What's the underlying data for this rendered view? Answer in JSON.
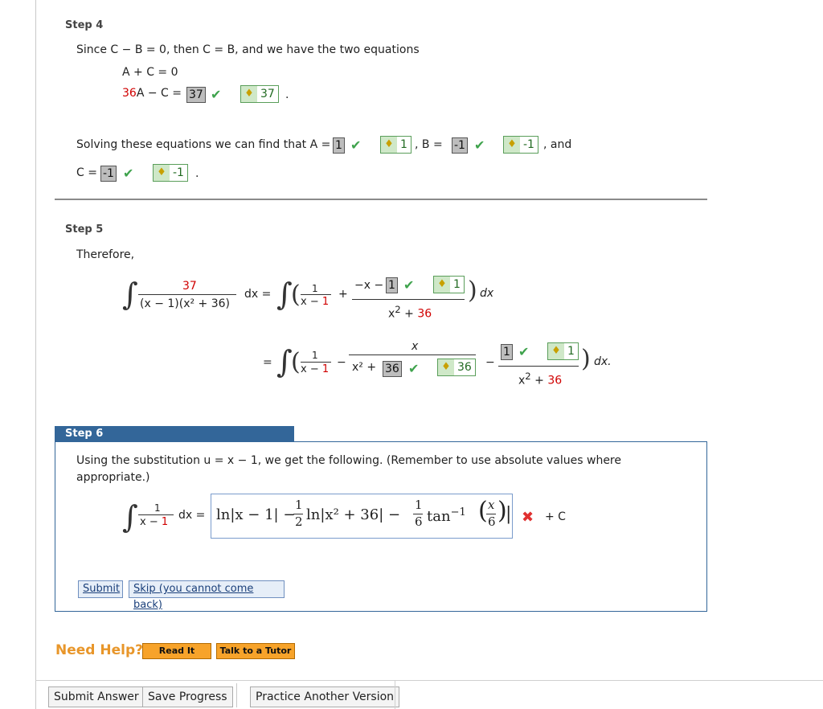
{
  "step4": {
    "label": "Step 4",
    "intro": "Since  C − B = 0,  then  C = B,  and we have the two equations",
    "eq1": "A + C = 0",
    "eq2_coef": "36",
    "eq2_rest": "A − C = ",
    "eq2_answer": "37",
    "eq2_key": "37",
    "period": ".",
    "solving_text": "Solving these equations we can find that A = ",
    "A_answer": "1",
    "A_key": "1",
    "B_text": ", B = ",
    "B_answer": "-1",
    "B_key": "-1",
    "and_text": ", and",
    "C_text": "C = ",
    "C_answer": "-1",
    "C_key": "-1"
  },
  "step5": {
    "label": "Step 5",
    "therefore": "Therefore,",
    "lhs_num": "37",
    "lhs_den": "(x − 1)(x² + 36)",
    "dx_eq": "dx  =",
    "one": "1",
    "x_minus_1_a": "x − ",
    "x_minus_1_b": "1",
    "plus": "+",
    "neg_x_minus": "−x − ",
    "ans1": "1",
    "key1": "1",
    "den_x2": "x",
    "den_sup": "2",
    "den_plus": " + ",
    "den_36": "36",
    "dx": "dx",
    "equals": "=",
    "minus": "−",
    "x_num": "x",
    "x2_plus": "x² + ",
    "ans36": "36",
    "key36": "36",
    "ans1b": "1",
    "key1b": "1",
    "dx_period": "dx."
  },
  "step6": {
    "label": "Step 6",
    "text1": "Using the substitution  u = x − 1,  we get the following. (Remember to use absolute values where",
    "text2": "appropriate.)",
    "int_num": "1",
    "int_den_a": "x − ",
    "int_den_b": "1",
    "dx_eq": "dx =",
    "answer_ln1": "ln|x − 1| − ",
    "frac_half_n": "1",
    "frac_half_d": "2",
    "answer_ln2": "ln|x² + 36| − ",
    "frac_sixth_n": "1",
    "frac_sixth_d": "6",
    "answer_tan": "tan",
    "answer_tan_sup": "−1",
    "arg_n": "x",
    "arg_d": "6",
    "plus_c": "+ C",
    "submit": "Submit",
    "skip": "Skip (you cannot come back)"
  },
  "help": {
    "label": "Need Help?",
    "read_it": "Read It",
    "tutor": "Talk to a Tutor"
  },
  "footer": {
    "submit_answer": "Submit Answer",
    "save_progress": "Save Progress",
    "practice": "Practice Another Version"
  },
  "icons": {
    "check": "✔",
    "cross": "✖",
    "key": "🔑"
  },
  "colors": {
    "red": "#d00000",
    "accent_blue": "#336699",
    "check_green": "#3fa34d",
    "help_orange": "#e8962a"
  }
}
